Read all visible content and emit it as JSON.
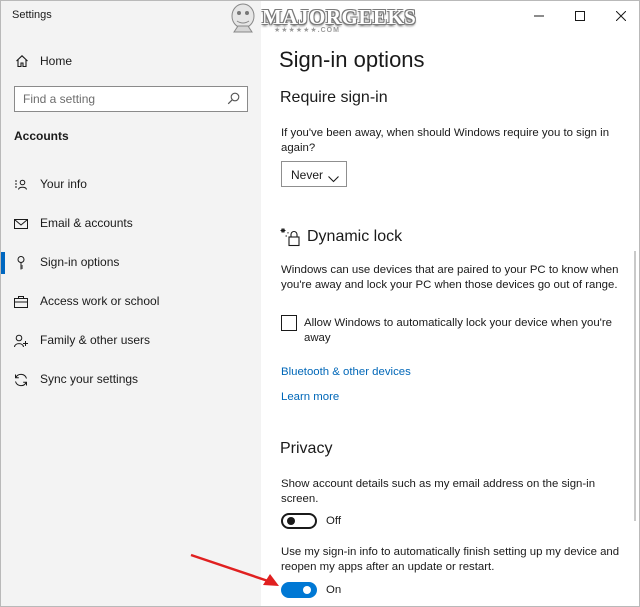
{
  "window": {
    "title": "Settings"
  },
  "watermark": {
    "logo_text": "MAJORGEEKS",
    "logo_sub": "★★★★★★.COM"
  },
  "sidebar": {
    "home_label": "Home",
    "search_placeholder": "Find a setting",
    "section_heading": "Accounts",
    "items": [
      {
        "label": "Your info",
        "icon": "person-card-icon"
      },
      {
        "label": "Email & accounts",
        "icon": "mail-icon"
      },
      {
        "label": "Sign-in options",
        "icon": "key-icon",
        "active": true
      },
      {
        "label": "Access work or school",
        "icon": "briefcase-icon"
      },
      {
        "label": "Family & other users",
        "icon": "add-person-icon"
      },
      {
        "label": "Sync your settings",
        "icon": "sync-icon"
      }
    ]
  },
  "content": {
    "page_title": "Sign-in options",
    "require_signin": {
      "heading": "Require sign-in",
      "description": "If you've been away, when should Windows require you to sign in again?",
      "dropdown_value": "Never"
    },
    "dynamic_lock": {
      "heading": "Dynamic lock",
      "description": "Windows can use devices that are paired to your PC to know when you're away and lock your PC when those devices go out of range.",
      "checkbox_label": "Allow Windows to automatically lock your device when you're away",
      "checkbox_checked": false,
      "link_devices": "Bluetooth & other devices",
      "link_learn": "Learn more"
    },
    "privacy": {
      "heading": "Privacy",
      "account_details_desc": "Show account details such as my email address on the sign-in screen.",
      "account_details_state": "Off",
      "signin_info_desc": "Use my sign-in info to automatically finish setting up my device and reopen my apps after an update or restart.",
      "signin_info_state": "On"
    }
  },
  "colors": {
    "accent": "#0078d4",
    "link": "#0067b8",
    "sidebar_bg": "#f3f3f3",
    "annotation_arrow": "#e02020"
  }
}
